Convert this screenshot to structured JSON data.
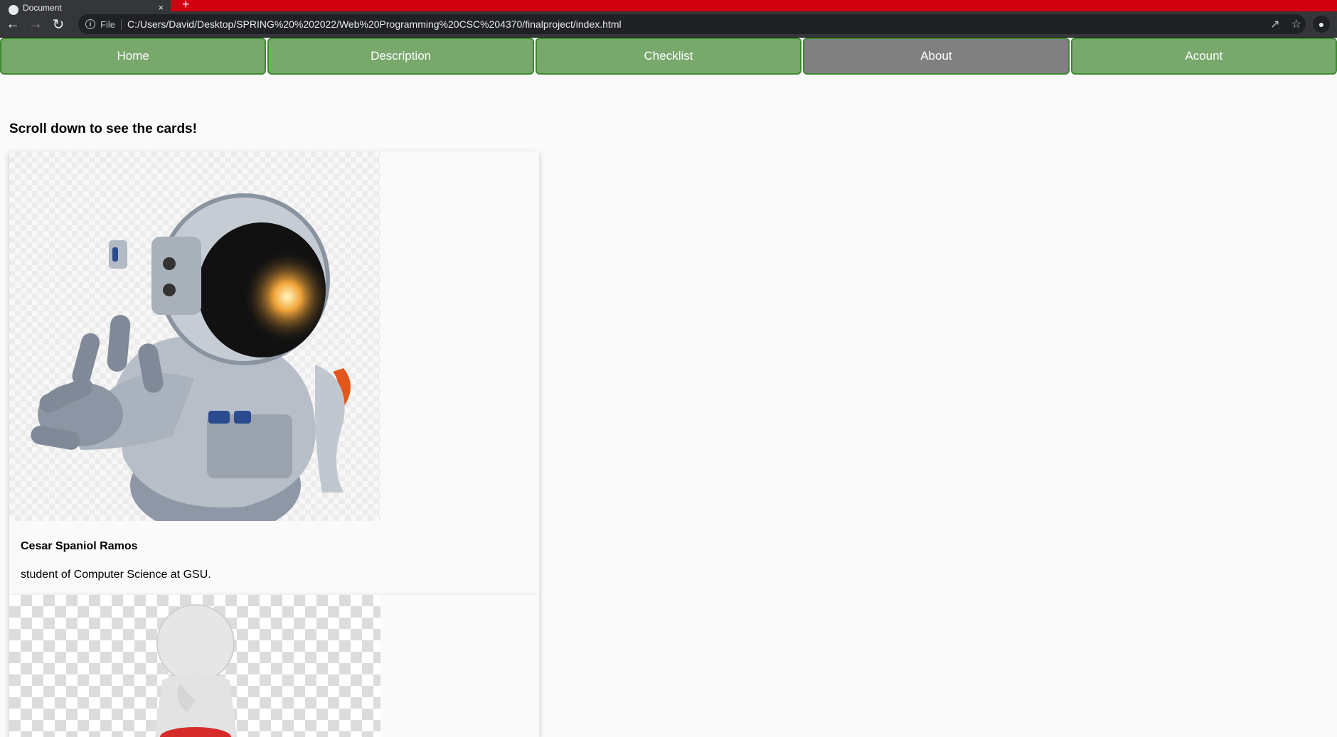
{
  "browser": {
    "tab_title": "Document",
    "tab_close": "×",
    "new_tab": "+",
    "file_label": "File",
    "url": "C:/Users/David/Desktop/SPRING%20%202022/Web%20Programming%20CSC%204370/finalproject/index.html"
  },
  "nav": {
    "items": [
      {
        "label": "Home"
      },
      {
        "label": "Description"
      },
      {
        "label": "Checklist"
      },
      {
        "label": "About"
      },
      {
        "label": "Acount"
      }
    ],
    "active": "About"
  },
  "page": {
    "heading": "Scroll down to see the cards!"
  },
  "cards": [
    {
      "name": "Cesar Spaniol Ramos",
      "description": "student of Computer Science at GSU."
    },
    {
      "name": "",
      "description": ""
    }
  ],
  "colors": {
    "tabstrip": "#d00010",
    "nav_green": "#78a86c",
    "nav_active": "#808080"
  }
}
